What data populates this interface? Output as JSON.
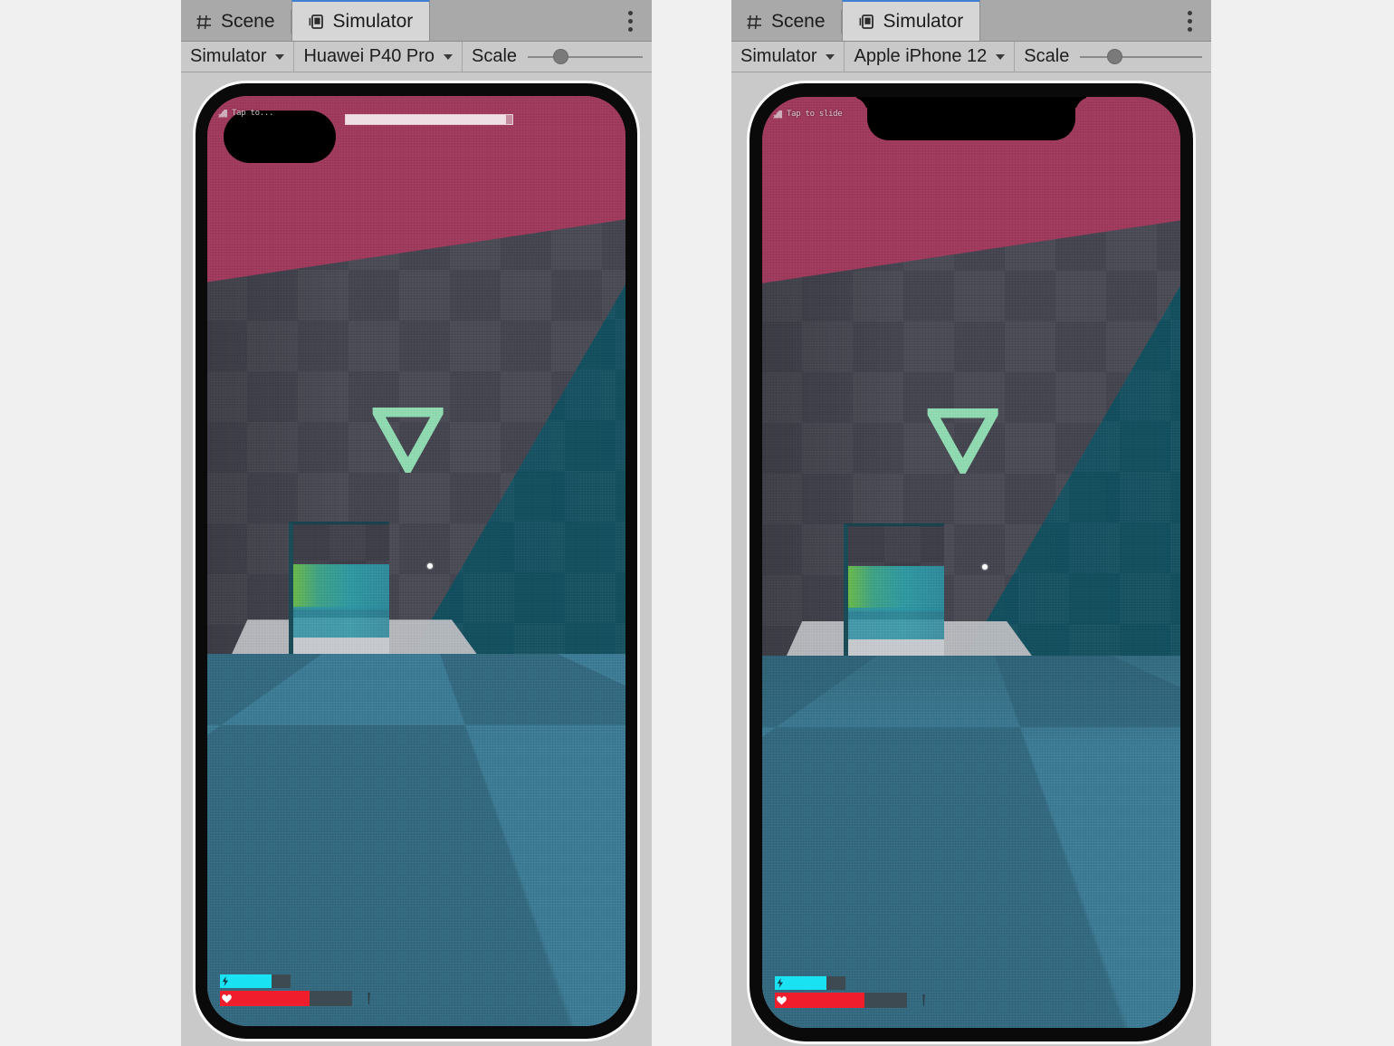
{
  "window": {
    "background_color": "#f0f0f0",
    "panel_background": "#c9c9c9"
  },
  "panels": [
    {
      "id": "left",
      "tabs": [
        {
          "label": "Scene",
          "icon": "grid-icon",
          "active": false
        },
        {
          "label": "Simulator",
          "icon": "device-icon",
          "active": true
        }
      ],
      "overflow_menu": "kebab-menu-icon",
      "toolbar": {
        "mode_label": "Simulator",
        "device_label": "Huawei P40 Pro",
        "scale_label": "Scale",
        "scale_value": 22
      },
      "device": {
        "name": "Huawei P40 Pro",
        "cutout": "punch-hole",
        "hud": {
          "top_label": "Tap to...",
          "progress_percent": 96,
          "mana_percent": 73,
          "health_percent": 68
        }
      }
    },
    {
      "id": "right",
      "tabs": [
        {
          "label": "Scene",
          "icon": "grid-icon",
          "active": false
        },
        {
          "label": "Simulator",
          "icon": "device-icon",
          "active": true
        }
      ],
      "overflow_menu": "kebab-menu-icon",
      "toolbar": {
        "mode_label": "Simulator",
        "device_label": "Apple iPhone 12",
        "scale_label": "Scale",
        "scale_value": 22
      },
      "device": {
        "name": "Apple iPhone 12",
        "cutout": "notch",
        "hud": {
          "top_label": "Tap to slide",
          "progress_percent": 0,
          "mana_percent": 73,
          "health_percent": 68
        }
      }
    }
  ],
  "scene": {
    "sky_color": "#9e3a5c",
    "wall_color": "#454550",
    "wall_shadow_color": "#12505f",
    "floor_light_color": "#3d7a93",
    "floor_dark_color": "#34697f",
    "platform_color": "#b9bcc0",
    "waypoint_color": "#8fd9b0",
    "waypoint_icon": "down-triangle-waypoint-icon",
    "crosshair_color": "#ffffff",
    "mana_bar_color": "#19e3f2",
    "health_bar_color": "#f01d2c",
    "bar_track_color": "#3d4a52"
  },
  "accent": {
    "active_tab_underline": "#3d7fd0",
    "active_tab_bg": "#d6d6d6",
    "tabstrip_bg": "#a9a9a9"
  }
}
